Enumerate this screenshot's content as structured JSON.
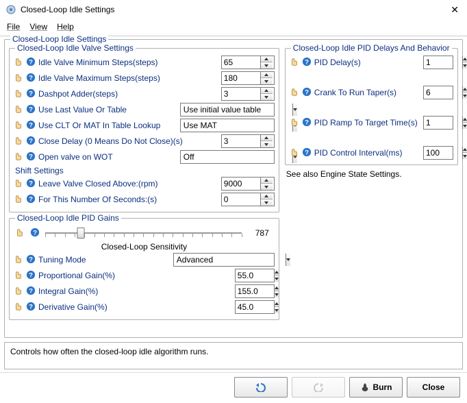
{
  "window": {
    "title": "Closed-Loop Idle Settings"
  },
  "menu": {
    "file": "File",
    "view": "View",
    "help": "Help"
  },
  "outer_legend": "Closed-Loop Idle Settings",
  "valve": {
    "legend": "Closed-Loop Idle Valve Settings",
    "min_steps_label": "Idle Valve Minimum Steps(steps)",
    "min_steps": "65",
    "max_steps_label": "Idle Valve Maximum Steps(steps)",
    "max_steps": "180",
    "dashpot_label": "Dashpot Adder(steps)",
    "dashpot": "3",
    "last_value_label": "Use Last Value Or Table",
    "last_value": "Use initial value table",
    "clt_mat_label": "Use CLT Or MAT In Table Lookup",
    "clt_mat": "Use MAT",
    "close_delay_label": "Close Delay (0 Means Do Not Close)(s)",
    "close_delay": "3",
    "wot_label": "Open valve on WOT",
    "wot": "Off",
    "shift_header": "Shift Settings",
    "shift_above_label": "Leave Valve Closed Above:(rpm)",
    "shift_above": "9000",
    "shift_secs_label": "For This Number Of Seconds:(s)",
    "shift_secs": "0"
  },
  "gains": {
    "legend": "Closed-Loop Idle PID Gains",
    "slider_value": "787",
    "slider_caption": "Closed-Loop Sensitivity",
    "tuning_mode_label": "Tuning Mode",
    "tuning_mode": "Advanced",
    "p_label": "Proportional Gain(%)",
    "p": "55.0",
    "i_label": "Integral Gain(%)",
    "i": "155.0",
    "d_label": "Derivative Gain(%)",
    "d": "45.0"
  },
  "delays": {
    "legend": "Closed-Loop Idle PID Delays And Behavior",
    "pid_delay_label": "PID Delay(s)",
    "pid_delay": "1",
    "taper_label": "Crank To Run Taper(s)",
    "taper": "6",
    "ramp_label": "PID Ramp To Target Time(s)",
    "ramp": "1",
    "interval_label": "PID Control Interval(ms)",
    "interval": "100",
    "see_also": "See also Engine State Settings."
  },
  "status": "Controls how often the closed-loop idle algorithm runs.",
  "buttons": {
    "burn": "Burn",
    "close": "Close"
  }
}
